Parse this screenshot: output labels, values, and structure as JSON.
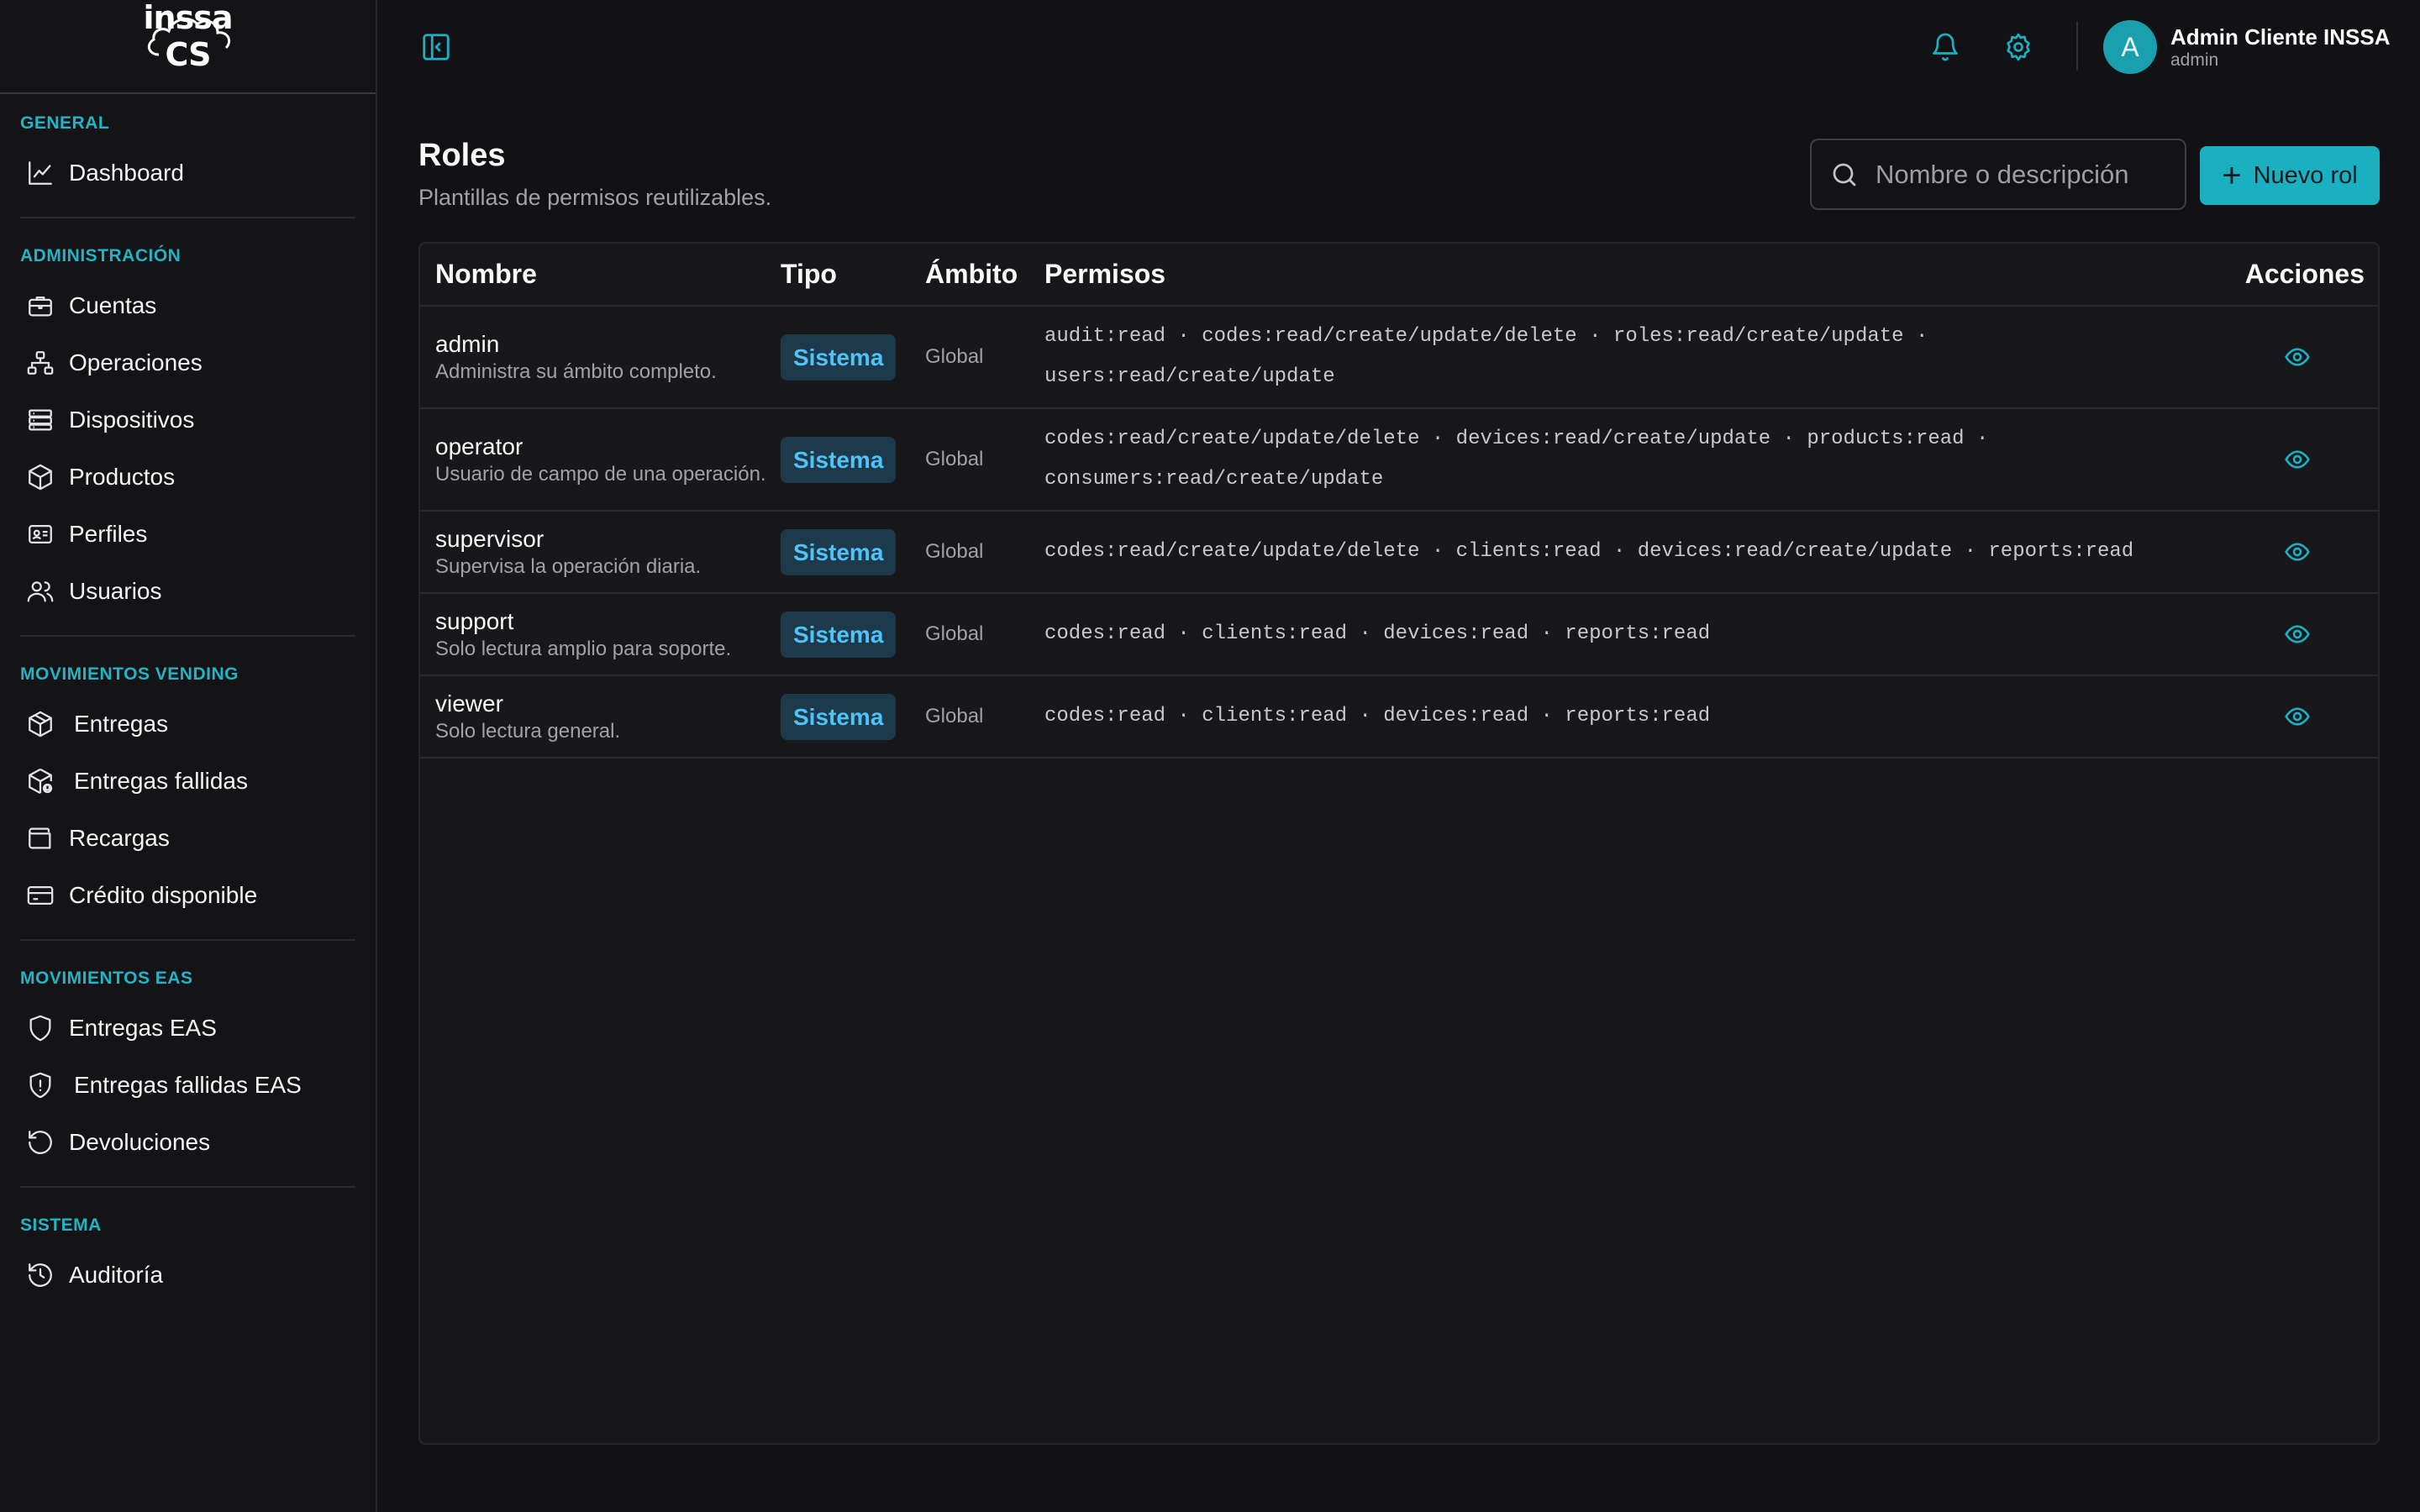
{
  "logo": {
    "text": "inssa CS"
  },
  "sidebar": {
    "sections": [
      {
        "heading": "GENERAL",
        "items": [
          {
            "label": "Dashboard",
            "icon": "chart-line-icon"
          }
        ]
      },
      {
        "heading": "ADMINISTRACIÓN",
        "items": [
          {
            "label": "Cuentas",
            "icon": "briefcase-icon"
          },
          {
            "label": "Operaciones",
            "icon": "network-icon"
          },
          {
            "label": "Dispositivos",
            "icon": "server-icon"
          },
          {
            "label": "Productos",
            "icon": "box-icon"
          },
          {
            "label": "Perfiles",
            "icon": "id-card-icon"
          },
          {
            "label": "Usuarios",
            "icon": "users-icon"
          }
        ]
      },
      {
        "heading": "MOVIMIENTOS VENDING",
        "items": [
          {
            "label": "Entregas",
            "icon": "package-icon"
          },
          {
            "label": "Entregas fallidas",
            "icon": "package-alert-icon"
          },
          {
            "label": "Recargas",
            "icon": "wallet-icon"
          },
          {
            "label": "Crédito disponible",
            "icon": "credit-card-icon"
          }
        ]
      },
      {
        "heading": "MOVIMIENTOS EAS",
        "items": [
          {
            "label": "Entregas EAS",
            "icon": "shield-icon"
          },
          {
            "label": "Entregas fallidas EAS",
            "icon": "shield-alert-icon"
          },
          {
            "label": "Devoluciones",
            "icon": "rotate-ccw-icon"
          }
        ]
      },
      {
        "heading": "SISTEMA",
        "items": [
          {
            "label": "Auditoría",
            "icon": "history-icon"
          }
        ]
      }
    ]
  },
  "topbar": {
    "user": {
      "initial": "A",
      "name": "Admin Cliente INSSA",
      "role": "admin"
    }
  },
  "page": {
    "title": "Roles",
    "subtitle": "Plantillas de permisos reutilizables.",
    "search_placeholder": "Nombre o descripción",
    "new_button": "Nuevo rol"
  },
  "table": {
    "headers": {
      "name": "Nombre",
      "type": "Tipo",
      "scope": "Ámbito",
      "perms": "Permisos",
      "actions": "Acciones"
    },
    "rows": [
      {
        "name": "admin",
        "desc": "Administra su ámbito completo.",
        "type": "Sistema",
        "scope": "Global",
        "perms_line1": "audit:read · codes:read/create/update/delete · roles:read/create/update ·",
        "perms_line2": "users:read/create/update"
      },
      {
        "name": "operator",
        "desc": "Usuario de campo de una operación.",
        "type": "Sistema",
        "scope": "Global",
        "perms_line1": "codes:read/create/update/delete · devices:read/create/update · products:read ·",
        "perms_line2": "consumers:read/create/update"
      },
      {
        "name": "supervisor",
        "desc": "Supervisa la operación diaria.",
        "type": "Sistema",
        "scope": "Global",
        "perms_line1": "codes:read/create/update/delete · clients:read · devices:read/create/update · reports:read"
      },
      {
        "name": "support",
        "desc": "Solo lectura amplio para soporte.",
        "type": "Sistema",
        "scope": "Global",
        "perms_line1": "codes:read · clients:read · devices:read · reports:read"
      },
      {
        "name": "viewer",
        "desc": "Solo lectura general.",
        "type": "Sistema",
        "scope": "Global",
        "perms_line1": "codes:read · clients:read · devices:read · reports:read"
      }
    ]
  },
  "colors": {
    "accent": "#1ab0c2",
    "badge_bg": "#1d3a4c",
    "badge_text": "#4fc3f7"
  }
}
